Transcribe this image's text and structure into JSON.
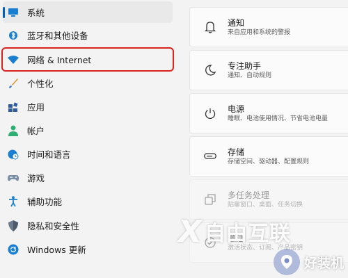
{
  "sidebar": {
    "items": [
      {
        "label": "系统",
        "icon": "monitor-icon",
        "selected": true
      },
      {
        "label": "蓝牙和其他设备",
        "icon": "bluetooth-icon"
      },
      {
        "label": "网络 & Internet",
        "icon": "wifi-icon",
        "highlighted": true
      },
      {
        "label": "个性化",
        "icon": "paintbrush-icon"
      },
      {
        "label": "应用",
        "icon": "apps-icon"
      },
      {
        "label": "帐户",
        "icon": "person-icon"
      },
      {
        "label": "时间和语言",
        "icon": "globe-clock-icon"
      },
      {
        "label": "游戏",
        "icon": "gamepad-icon"
      },
      {
        "label": "辅助功能",
        "icon": "accessibility-icon"
      },
      {
        "label": "隐私和安全性",
        "icon": "shield-icon"
      },
      {
        "label": "Windows 更新",
        "icon": "update-icon"
      }
    ]
  },
  "settings": {
    "cards": [
      {
        "title": "通知",
        "subtitle": "来自应用和系统的警报",
        "icon": "bell-icon"
      },
      {
        "title": "专注助手",
        "subtitle": "通知、自动规则",
        "icon": "moon-icon"
      },
      {
        "title": "电源",
        "subtitle": "睡眠、电池使用情况、节省电池电量",
        "icon": "power-icon"
      },
      {
        "title": "存储",
        "subtitle": "存储空间、驱动器、配置规则",
        "icon": "storage-icon"
      },
      {
        "title": "多任务处理",
        "subtitle": "贴靠窗口、桌面、任务切换",
        "icon": "multitask-icon"
      },
      {
        "title": "激活",
        "subtitle": "激活状态、订阅、产品密钥",
        "icon": "check-circle-icon"
      }
    ]
  },
  "watermark": {
    "brand": "自由互联",
    "logo": "好装机"
  },
  "colors": {
    "accent": "#005fb8",
    "highlight_box": "#d9221c"
  }
}
